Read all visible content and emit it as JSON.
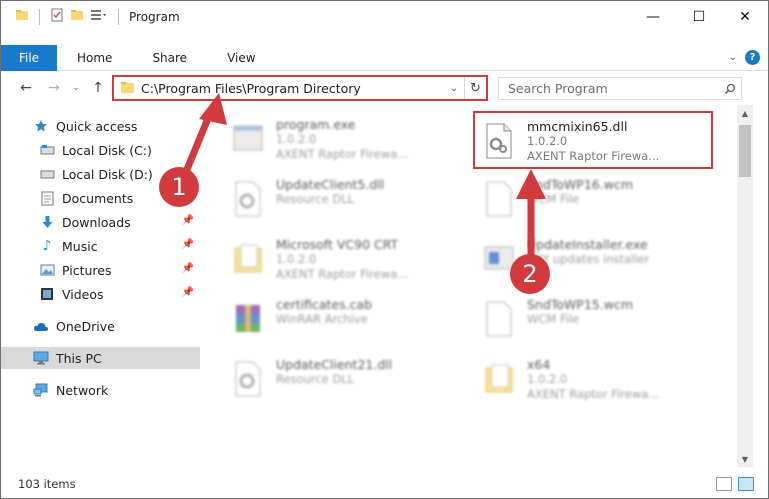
{
  "window": {
    "title": "Program"
  },
  "ribbon": {
    "file_label": "File",
    "tabs": [
      "Home",
      "Share",
      "View"
    ]
  },
  "address": {
    "path": "C:\\Program Files\\Program Directory"
  },
  "search": {
    "placeholder": "Search Program"
  },
  "sidebar": {
    "quick_access": "Quick access",
    "items": [
      {
        "label": "Local Disk (C:)",
        "icon": "drive-icon"
      },
      {
        "label": "Local Disk (D:)",
        "icon": "drive-icon"
      },
      {
        "label": "Documents",
        "icon": "documents-icon"
      },
      {
        "label": "Downloads",
        "icon": "downloads-icon"
      },
      {
        "label": "Music",
        "icon": "music-icon"
      },
      {
        "label": "Pictures",
        "icon": "pictures-icon"
      },
      {
        "label": "Videos",
        "icon": "videos-icon"
      }
    ],
    "onedrive": "OneDrive",
    "this_pc": "This PC",
    "network": "Network"
  },
  "files": {
    "left": [
      {
        "name": "program.exe",
        "line1": "1.0.2.0",
        "line2": "AXENT Raptor Firewa..."
      },
      {
        "name": "UpdateClient5.dll",
        "line1": "Resource DLL",
        "line2": ""
      },
      {
        "name": "Microsoft VC90 CRT",
        "line1": "1.0.2.0",
        "line2": "AXENT Raptor Firewa..."
      },
      {
        "name": "certificates.cab",
        "line1": "WinRAR Archive",
        "line2": ""
      },
      {
        "name": "UpdateClient21.dll",
        "line1": "Resource DLL",
        "line2": ""
      }
    ],
    "right": [
      {
        "name": "mmcmixin65.dll",
        "line1": "1.0.2.0",
        "line2": "AXENT Raptor Firewa..."
      },
      {
        "name": "SndToWP16.wcm",
        "line1": "WCM File",
        "line2": ""
      },
      {
        "name": "UpdateInstaller.exe",
        "line1": "BBY updates installer",
        "line2": ""
      },
      {
        "name": "SndToWP15.wcm",
        "line1": "WCM File",
        "line2": ""
      },
      {
        "name": "x64",
        "line1": "1.0.2.0",
        "line2": "AXENT Raptor Firewa..."
      }
    ]
  },
  "status": {
    "items_count": "103 items"
  },
  "annotations": {
    "step1": "1",
    "step2": "2"
  },
  "colors": {
    "accent": "#1979ca",
    "highlight": "#d23a3e"
  }
}
